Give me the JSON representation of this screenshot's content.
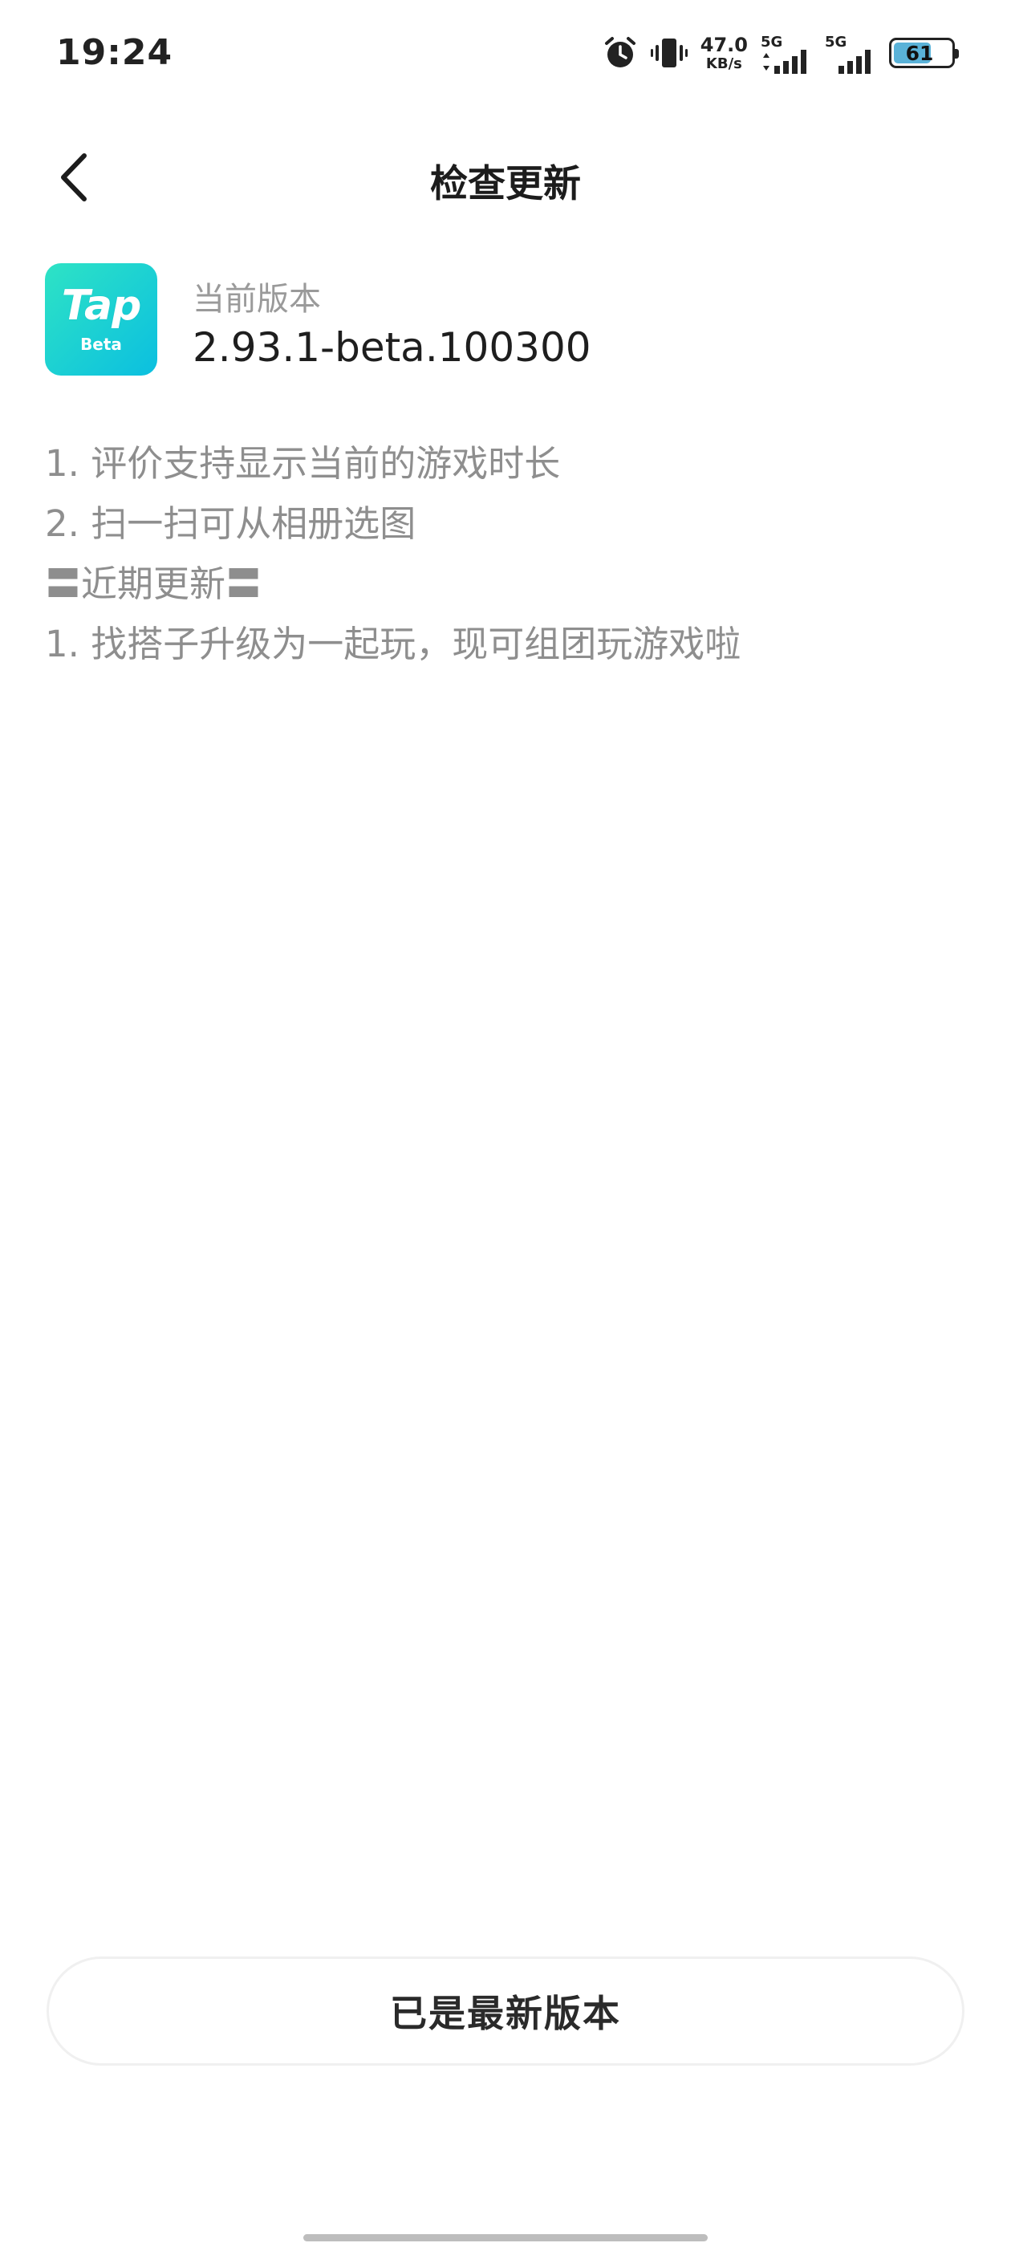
{
  "status_bar": {
    "time": "19:24",
    "net_speed_value": "47.0",
    "net_speed_unit": "KB/s",
    "sim1_label": "5G",
    "sim2_label": "5G",
    "battery": "61",
    "icons": [
      "alarm-icon",
      "vibrate-icon",
      "signal-icon",
      "battery-icon"
    ]
  },
  "nav": {
    "title": "检查更新",
    "back_icon": "chevron-left-icon"
  },
  "app": {
    "icon_text": "Tap",
    "icon_subtext": "Beta",
    "version_label": "当前版本",
    "version_value": "2.93.1-beta.100300"
  },
  "release_notes": [
    "1. 评价支持显示当前的游戏时长",
    "2. 扫一扫可从相册选图",
    "〓近期更新〓",
    "1. 找搭子升级为一起玩，现可组团玩游戏啦"
  ],
  "update_button_label": "已是最新版本",
  "colors": {
    "accent_gradient_start": "#2ee3c5",
    "accent_gradient_end": "#0bbfe0",
    "battery_fill": "#5ab2d8",
    "secondary_text": "#8e8e8e"
  }
}
